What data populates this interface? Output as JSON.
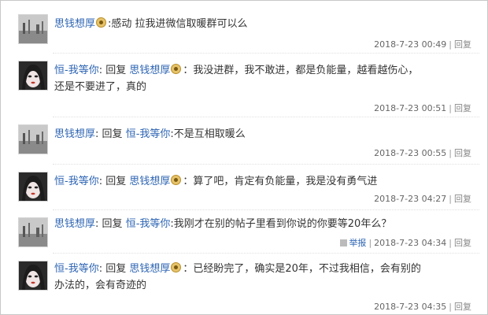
{
  "replies": [
    {
      "user": "思钱想厚",
      "avatar": "grey-scenery",
      "text": "感动 拉我进微信取暖群可以么",
      "time": "2018-7-23 00:49",
      "action": "回复"
    },
    {
      "user": "恒-我等你",
      "avatar": "girl-face",
      "reply_word": "回复",
      "target": "思钱想厚",
      "text": "：我没进群，我不敢进，都是负能量，越看越伤心，还是不要进了，真的",
      "text_line1": "：我没进群，我不敢进，都是负能量，越看越伤心，",
      "text_line2": "还是不要进了，真的",
      "time": "2018-7-23 00:51",
      "action": "回复"
    },
    {
      "user": "思钱想厚",
      "avatar": "grey-scenery",
      "reply_word": "回复",
      "target": "恒-我等你",
      "text": ":不是互相取暖么",
      "time": "2018-7-23 00:55",
      "action": "回复"
    },
    {
      "user": "恒-我等你",
      "avatar": "girl-face",
      "reply_word": "回复",
      "target": "思钱想厚",
      "text": "：算了吧，肯定有负能量，我是没有勇气进",
      "time": "2018-7-23 04:27",
      "action": "回复"
    },
    {
      "user": "思钱想厚",
      "avatar": "grey-scenery",
      "reply_word": "回复",
      "target": "恒-我等你",
      "text": ":我刚才在别的帖子里看到你说的你要等20年么？",
      "report": "举报",
      "time": "2018-7-23 04:34",
      "action": "回复"
    },
    {
      "user": "恒-我等你",
      "avatar": "girl-face",
      "reply_word": "回复",
      "target": "思钱想厚",
      "text": "：已经盼完了，确实是20年，不过我相信，会有别的办法的，会有奇迹的",
      "text_line1": "：已经盼完了，确实是20年，不过我相信，会有别的",
      "text_line2": "办法的，会有奇迹的",
      "time": "2018-7-23 04:35",
      "action": "回复"
    }
  ],
  "colors": {
    "username": "#2d64b3",
    "text": "#333333",
    "meta": "#666666",
    "border": "#c8c8c8"
  }
}
